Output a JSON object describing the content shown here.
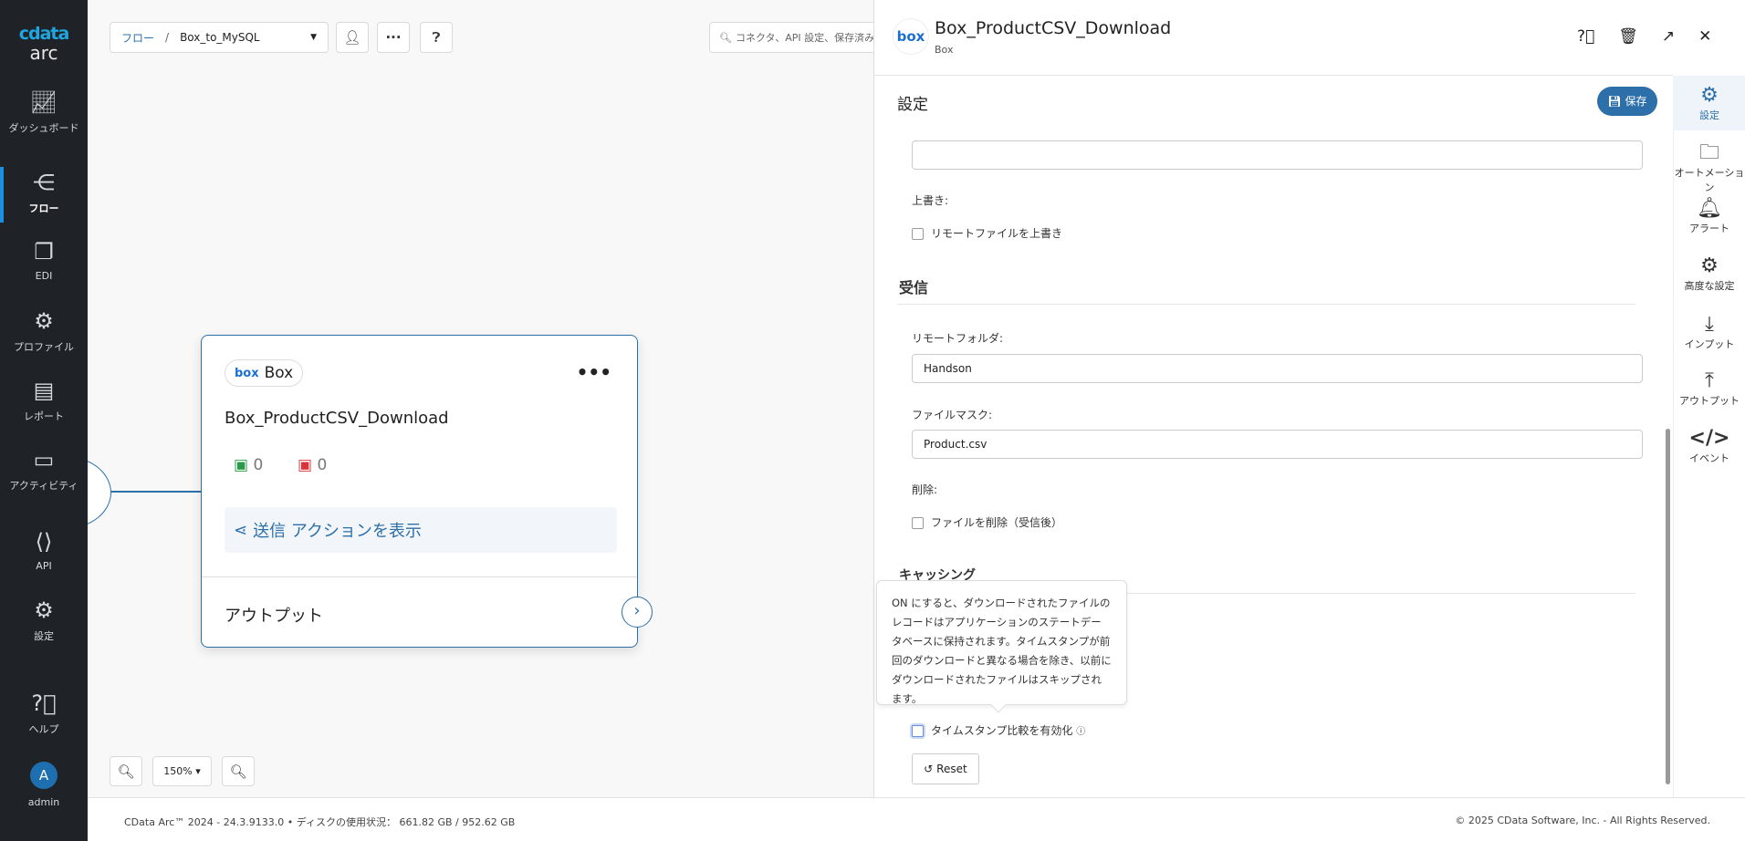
{
  "app": {
    "logo_top": "cdata",
    "logo_bottom": "arc"
  },
  "sidebar": {
    "items": [
      {
        "label": "ダッシュボード",
        "icon": "chart-line-icon"
      },
      {
        "label": "フロー",
        "icon": "share-nodes-icon"
      },
      {
        "label": "EDI",
        "icon": "copy-icon"
      },
      {
        "label": "プロファイル",
        "icon": "gears-icon"
      },
      {
        "label": "レポート",
        "icon": "file-icon"
      },
      {
        "label": "アクティビティ",
        "icon": "layers-icon"
      },
      {
        "label": "API",
        "icon": "code-file-icon"
      },
      {
        "label": "設定",
        "icon": "gear-icon"
      },
      {
        "label": "ヘルプ",
        "icon": "help-icon"
      },
      {
        "label": "admin",
        "avatar": "A"
      }
    ]
  },
  "toolbar": {
    "breadcrumb_root": "フロー",
    "breadcrumb_sep": "/",
    "flow_name": "Box_to_MySQL",
    "search_placeholder": "コネクタ、API 設定、保存済み"
  },
  "node": {
    "badge": "Box",
    "badge_logo": "box",
    "title": "Box_ProductCSV_Download",
    "success_count": "0",
    "error_count": "0",
    "action_link": "送信 アクションを表示",
    "output_label": "アウトプット"
  },
  "zoom": {
    "level": "150%"
  },
  "panel": {
    "title": "Box_ProductCSV_Download",
    "subtitle": "Box",
    "logo": "box",
    "section_title": "設定",
    "save_label": "保存",
    "overwrite_label": "上書き:",
    "overwrite_checkbox": "リモートファイルを上書き",
    "receive_heading": "受信",
    "remote_folder_label": "リモートフォルダ:",
    "remote_folder_value": "Handson",
    "file_mask_label": "ファイルマスク:",
    "file_mask_value": "Product.csv",
    "delete_label": "削除:",
    "delete_checkbox": "ファイルを削除（受信後）",
    "caching_heading": "キャッシング",
    "tooltip": "ON にすると、ダウンロードされたファイルのレコードはアプリケーションのステートデータベースに保持されます。タイムスタンプが前回のダウンロードと異なる場合を除き、以前にダウンロードされたファイルはスキップされます。",
    "timestamp_checkbox": "タイムスタンプ比較を有効化",
    "reset_label": "Reset"
  },
  "rail": {
    "items": [
      "設定",
      "オートメーション",
      "アラート",
      "高度な設定",
      "インプット",
      "アウトプット",
      "イベント"
    ]
  },
  "footer": {
    "version": "CData Arc™ 2024 - 24.3.9133.0",
    "sep": "•",
    "disk": "ディスクの使用状況： 661.82 GB / 952.62 GB",
    "copyright": "© 2025 CData Software, Inc. - All Rights Reserved."
  },
  "colors": {
    "accent": "#2d6fa8",
    "sidebar": "#1f2327",
    "active": "#1d8fe0"
  }
}
